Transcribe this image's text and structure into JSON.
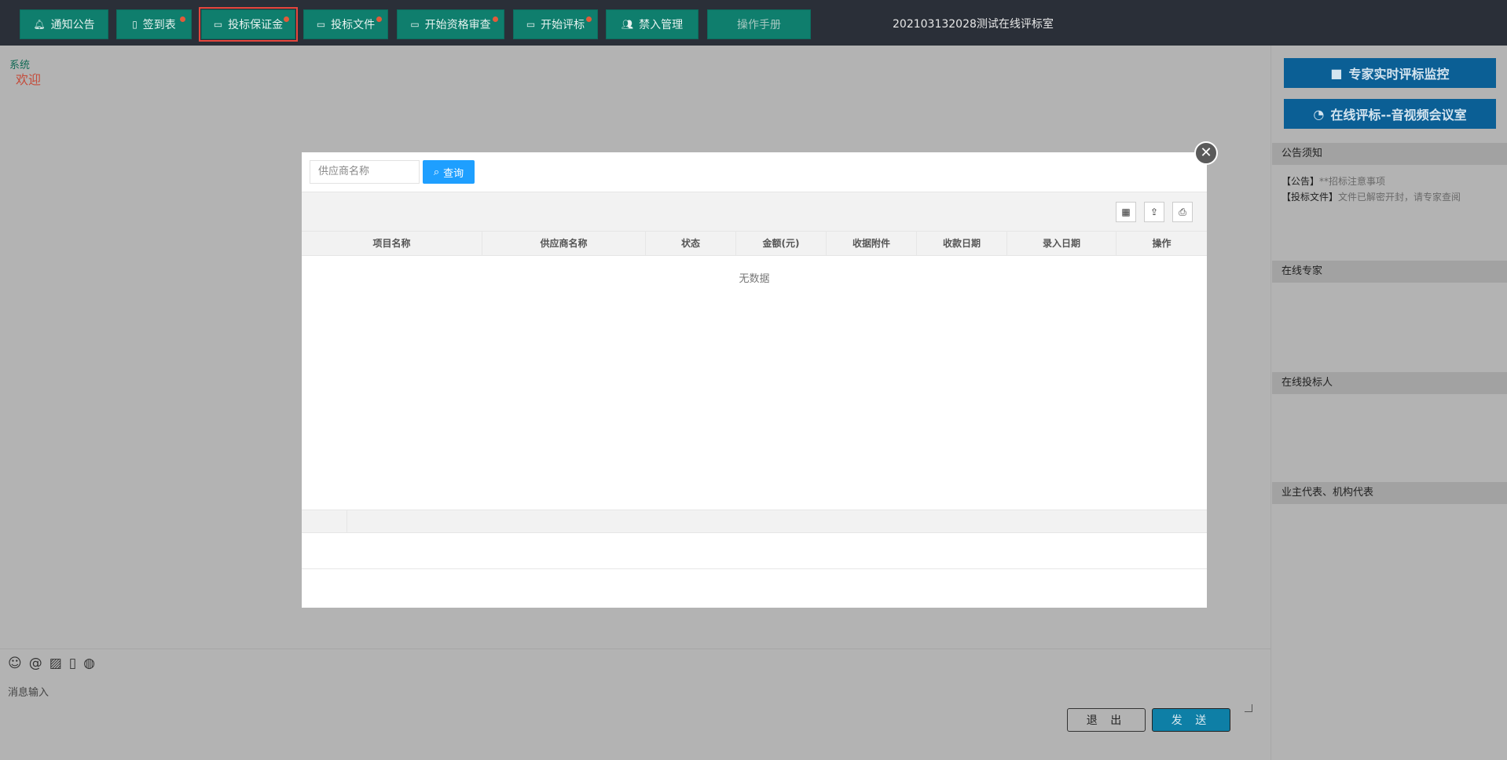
{
  "nav": {
    "items": [
      {
        "label": "通知公告",
        "icon": "bell-icon",
        "dot": false
      },
      {
        "label": "签到表",
        "icon": "file-icon",
        "dot": true
      },
      {
        "label": "投标保证金",
        "icon": "window-icon",
        "dot": true,
        "active": true
      },
      {
        "label": "投标文件",
        "icon": "window-icon",
        "dot": true
      },
      {
        "label": "开始资格审查",
        "icon": "window-icon",
        "dot": true
      },
      {
        "label": "开始评标",
        "icon": "window-icon",
        "dot": true
      },
      {
        "label": "禁入管理",
        "icon": "users-icon",
        "dot": false
      },
      {
        "label": "操作手册",
        "icon": "",
        "dot": false
      }
    ],
    "room_title": "202103132028测试在线评标室"
  },
  "chat": {
    "system_label": "系统",
    "welcome": "欢迎",
    "input_placeholder": "消息输入",
    "exit_label": "退 出",
    "send_label": "发 送"
  },
  "right": {
    "monitor_button": "专家实时评标监控",
    "meeting_button": "在线评标--音视频会议室",
    "notice_header": "公告须知",
    "notices": [
      {
        "tag": "【公告】",
        "text": "**招标注意事项"
      },
      {
        "tag": "【投标文件】",
        "text": "文件已解密开封，请专家查阅"
      }
    ],
    "experts_header": "在线专家",
    "bidders_header": "在线投标人",
    "owners_header": "业主代表、机构代表"
  },
  "modal": {
    "search_placeholder": "供应商名称",
    "search_button": "查询",
    "columns": [
      "项目名称",
      "供应商名称",
      "状态",
      "金额(元)",
      "收据附件",
      "收款日期",
      "录入日期",
      "操作"
    ],
    "empty_text": "无数据"
  },
  "colors": {
    "nav_button": "#0f7e6d",
    "active_outline": "#e5473d",
    "right_button": "#0b5f95",
    "query_button": "#1e9fff"
  }
}
